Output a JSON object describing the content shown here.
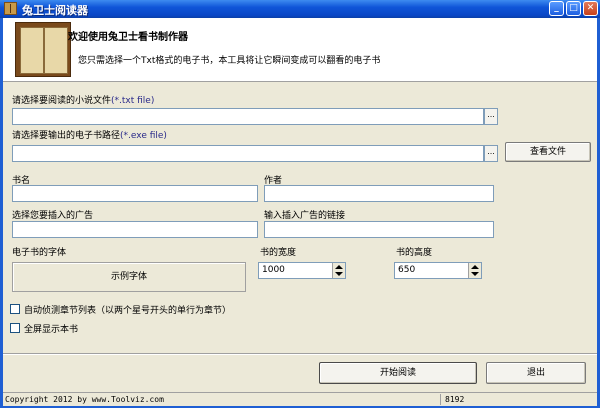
{
  "window": {
    "title": "兔卫士阅读器"
  },
  "header": {
    "title": "欢迎使用兔卫士看书制作器",
    "description": "您只需选择一个Txt格式的电子书，本工具将让它瞬间变成可以翻看的电子书"
  },
  "source": {
    "label": "请选择要阅读的小说文件",
    "ext": "(*.txt file)",
    "value": "",
    "browse_label": "..."
  },
  "output": {
    "label": "请选择要输出的电子书路径",
    "ext": "(*.exe file)",
    "value": "",
    "browse_label": "...",
    "view_label": "查看文件"
  },
  "book": {
    "name_label": "书名",
    "name_value": "",
    "author_label": "作者",
    "author_value": "",
    "ad_label": "选择您要插入的广告",
    "ad_value": "",
    "adlink_label": "输入插入广告的链接",
    "adlink_value": ""
  },
  "font": {
    "label": "电子书的字体",
    "sample_label": "示例字体"
  },
  "size": {
    "width_label": "书的宽度",
    "width_value": "1000",
    "height_label": "书的高度",
    "height_value": "650"
  },
  "options": {
    "auto_chapter_label": "自动侦测章节列表（以两个星号开头的单行为章节）",
    "auto_chapter_checked": false,
    "fullscreen_label": "全屏显示本书",
    "fullscreen_checked": false
  },
  "actions": {
    "start_label": "开始阅读",
    "exit_label": "退出"
  },
  "statusbar": {
    "copyright": "Copyright 2012 by www.Toolviz.com",
    "count": "8192"
  },
  "colors": {
    "titlebar": "#0a47c6",
    "window_bg": "#ece9d8",
    "field_border": "#7f9db9"
  },
  "icons": {
    "app": "book-icon",
    "minimize": "minimize-icon",
    "maximize": "maximize-icon",
    "close": "close-icon"
  }
}
